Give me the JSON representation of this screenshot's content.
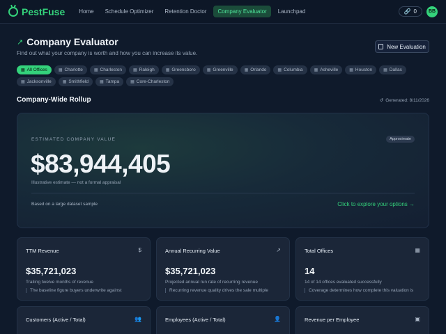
{
  "nav": {
    "brand": "PestFuse",
    "links": [
      "Home",
      "Schedule Optimizer",
      "Retention Doctor",
      "Company Evaluator",
      "Launchpad"
    ],
    "active_index": 3,
    "credits": "0",
    "avatar_initials": "BB"
  },
  "header": {
    "title": "Company Evaluator",
    "subtitle": "Find out what your company is worth and how you can increase its value.",
    "new_button": "New Evaluation"
  },
  "offices": {
    "chips": [
      "All Offices",
      "Charlotte",
      "Charleston",
      "Raleigh",
      "Greensboro",
      "Greenville",
      "Orlando",
      "Columbia",
      "Asheville",
      "Houston",
      "Dallas",
      "Jacksonville",
      "Smithfield",
      "Tampa",
      "Core-Charleston"
    ],
    "active_index": 0
  },
  "rollup": {
    "title": "Company-Wide Rollup",
    "generated": "Generated: 8/11/2026"
  },
  "hero": {
    "label": "ESTIMATED COMPANY VALUE",
    "badge": "Approximate",
    "value": "$83,944,405",
    "note": "Illustrative estimate — not a formal appraisal",
    "basis": "Based on a large dataset sample",
    "cta": "Click to explore your options →"
  },
  "cards": [
    {
      "title": "TTM Revenue",
      "icon": "dollar-icon",
      "value": "$35,721,023",
      "desc": "Trailing twelve months of revenue",
      "foot": "The baseline figure buyers underwrite against"
    },
    {
      "title": "Annual Recurring Value",
      "icon": "trend-up-icon",
      "value": "$35,721,023",
      "desc": "Projected annual run rate of recurring revenue",
      "foot": "Recurring revenue quality drives the sale multiple"
    },
    {
      "title": "Total Offices",
      "icon": "building-icon",
      "value": "14",
      "desc": "14 of 14 offices evaluated successfully",
      "foot": "Coverage determines how complete this valuation is"
    },
    {
      "title": "Customers (Active / Total)",
      "icon": "users-icon"
    },
    {
      "title": "Employees (Active / Total)",
      "icon": "user-check-icon"
    },
    {
      "title": "Revenue per Employee",
      "icon": "briefcase-icon"
    }
  ],
  "colors": {
    "background": "#0f1a2b",
    "accent": "#34d27b",
    "card": "#1b2638"
  }
}
